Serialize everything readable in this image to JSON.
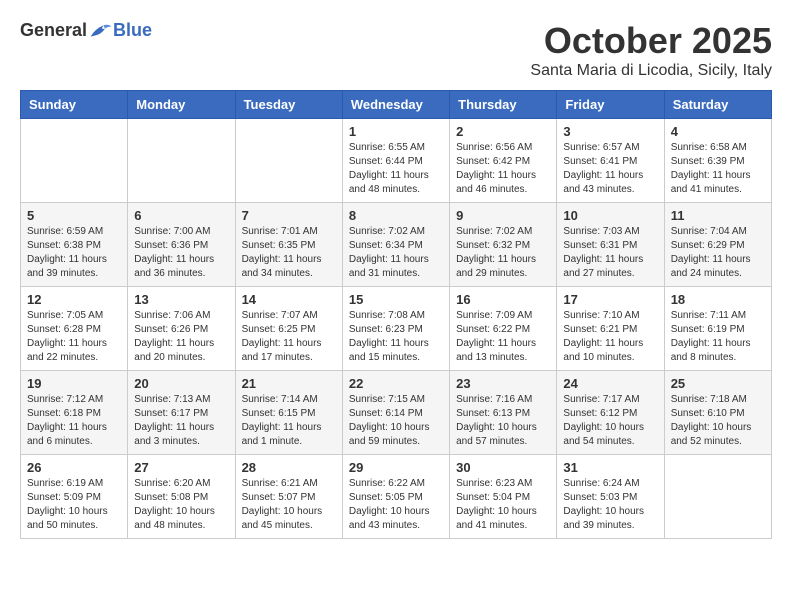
{
  "header": {
    "logo_general": "General",
    "logo_blue": "Blue",
    "month_title": "October 2025",
    "subtitle": "Santa Maria di Licodia, Sicily, Italy"
  },
  "weekdays": [
    "Sunday",
    "Monday",
    "Tuesday",
    "Wednesday",
    "Thursday",
    "Friday",
    "Saturday"
  ],
  "weeks": [
    [
      {
        "day": "",
        "info": ""
      },
      {
        "day": "",
        "info": ""
      },
      {
        "day": "",
        "info": ""
      },
      {
        "day": "1",
        "info": "Sunrise: 6:55 AM\nSunset: 6:44 PM\nDaylight: 11 hours\nand 48 minutes."
      },
      {
        "day": "2",
        "info": "Sunrise: 6:56 AM\nSunset: 6:42 PM\nDaylight: 11 hours\nand 46 minutes."
      },
      {
        "day": "3",
        "info": "Sunrise: 6:57 AM\nSunset: 6:41 PM\nDaylight: 11 hours\nand 43 minutes."
      },
      {
        "day": "4",
        "info": "Sunrise: 6:58 AM\nSunset: 6:39 PM\nDaylight: 11 hours\nand 41 minutes."
      }
    ],
    [
      {
        "day": "5",
        "info": "Sunrise: 6:59 AM\nSunset: 6:38 PM\nDaylight: 11 hours\nand 39 minutes."
      },
      {
        "day": "6",
        "info": "Sunrise: 7:00 AM\nSunset: 6:36 PM\nDaylight: 11 hours\nand 36 minutes."
      },
      {
        "day": "7",
        "info": "Sunrise: 7:01 AM\nSunset: 6:35 PM\nDaylight: 11 hours\nand 34 minutes."
      },
      {
        "day": "8",
        "info": "Sunrise: 7:02 AM\nSunset: 6:34 PM\nDaylight: 11 hours\nand 31 minutes."
      },
      {
        "day": "9",
        "info": "Sunrise: 7:02 AM\nSunset: 6:32 PM\nDaylight: 11 hours\nand 29 minutes."
      },
      {
        "day": "10",
        "info": "Sunrise: 7:03 AM\nSunset: 6:31 PM\nDaylight: 11 hours\nand 27 minutes."
      },
      {
        "day": "11",
        "info": "Sunrise: 7:04 AM\nSunset: 6:29 PM\nDaylight: 11 hours\nand 24 minutes."
      }
    ],
    [
      {
        "day": "12",
        "info": "Sunrise: 7:05 AM\nSunset: 6:28 PM\nDaylight: 11 hours\nand 22 minutes."
      },
      {
        "day": "13",
        "info": "Sunrise: 7:06 AM\nSunset: 6:26 PM\nDaylight: 11 hours\nand 20 minutes."
      },
      {
        "day": "14",
        "info": "Sunrise: 7:07 AM\nSunset: 6:25 PM\nDaylight: 11 hours\nand 17 minutes."
      },
      {
        "day": "15",
        "info": "Sunrise: 7:08 AM\nSunset: 6:23 PM\nDaylight: 11 hours\nand 15 minutes."
      },
      {
        "day": "16",
        "info": "Sunrise: 7:09 AM\nSunset: 6:22 PM\nDaylight: 11 hours\nand 13 minutes."
      },
      {
        "day": "17",
        "info": "Sunrise: 7:10 AM\nSunset: 6:21 PM\nDaylight: 11 hours\nand 10 minutes."
      },
      {
        "day": "18",
        "info": "Sunrise: 7:11 AM\nSunset: 6:19 PM\nDaylight: 11 hours\nand 8 minutes."
      }
    ],
    [
      {
        "day": "19",
        "info": "Sunrise: 7:12 AM\nSunset: 6:18 PM\nDaylight: 11 hours\nand 6 minutes."
      },
      {
        "day": "20",
        "info": "Sunrise: 7:13 AM\nSunset: 6:17 PM\nDaylight: 11 hours\nand 3 minutes."
      },
      {
        "day": "21",
        "info": "Sunrise: 7:14 AM\nSunset: 6:15 PM\nDaylight: 11 hours\nand 1 minute."
      },
      {
        "day": "22",
        "info": "Sunrise: 7:15 AM\nSunset: 6:14 PM\nDaylight: 10 hours\nand 59 minutes."
      },
      {
        "day": "23",
        "info": "Sunrise: 7:16 AM\nSunset: 6:13 PM\nDaylight: 10 hours\nand 57 minutes."
      },
      {
        "day": "24",
        "info": "Sunrise: 7:17 AM\nSunset: 6:12 PM\nDaylight: 10 hours\nand 54 minutes."
      },
      {
        "day": "25",
        "info": "Sunrise: 7:18 AM\nSunset: 6:10 PM\nDaylight: 10 hours\nand 52 minutes."
      }
    ],
    [
      {
        "day": "26",
        "info": "Sunrise: 6:19 AM\nSunset: 5:09 PM\nDaylight: 10 hours\nand 50 minutes."
      },
      {
        "day": "27",
        "info": "Sunrise: 6:20 AM\nSunset: 5:08 PM\nDaylight: 10 hours\nand 48 minutes."
      },
      {
        "day": "28",
        "info": "Sunrise: 6:21 AM\nSunset: 5:07 PM\nDaylight: 10 hours\nand 45 minutes."
      },
      {
        "day": "29",
        "info": "Sunrise: 6:22 AM\nSunset: 5:05 PM\nDaylight: 10 hours\nand 43 minutes."
      },
      {
        "day": "30",
        "info": "Sunrise: 6:23 AM\nSunset: 5:04 PM\nDaylight: 10 hours\nand 41 minutes."
      },
      {
        "day": "31",
        "info": "Sunrise: 6:24 AM\nSunset: 5:03 PM\nDaylight: 10 hours\nand 39 minutes."
      },
      {
        "day": "",
        "info": ""
      }
    ]
  ]
}
